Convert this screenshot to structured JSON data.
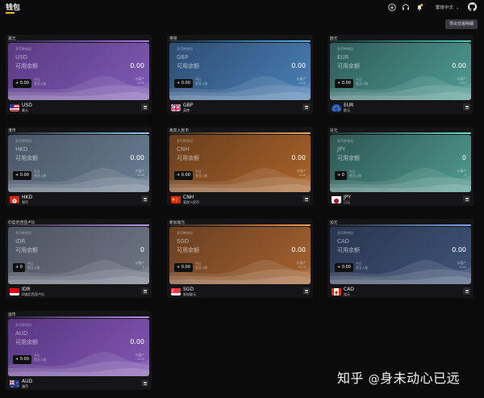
{
  "header": {
    "title": "钱包",
    "language": "繁体中文",
    "export_button": "导出交易明细"
  },
  "wallets": [
    {
      "name": "美元",
      "sub": "多币种钱包",
      "code": "USD",
      "available_label": "可用余额",
      "amount": "0.00",
      "today_change": "+ 0.00",
      "today_label": "今日",
      "today_sub": "营业入账",
      "asset_label": "价值产",
      "asset_value": "0.00",
      "currency_name": "美元",
      "accent": "#b07cf0",
      "panel_from": "#5b3a84",
      "panel_to": "#7e5bb4"
    },
    {
      "name": "英镑",
      "sub": "多币种钱包",
      "code": "GBP",
      "available_label": "可用余额",
      "amount": "0.00",
      "today_change": "+ 0.00",
      "today_label": "今日",
      "today_sub": "营业入账",
      "asset_label": "价值产",
      "asset_value": "0.00",
      "currency_name": "英镑",
      "accent": "#58b8f0",
      "panel_from": "#2d4d74",
      "panel_to": "#4a7fb5"
    },
    {
      "name": "欧元",
      "sub": "多币种钱包",
      "code": "EUR",
      "available_label": "可用余额",
      "amount": "0.00",
      "today_change": "+ 0.00",
      "today_label": "今日",
      "today_sub": "营业入账",
      "asset_label": "价值产",
      "asset_value": "0.00",
      "currency_name": "欧元",
      "accent": "#4fd0c0",
      "panel_from": "#2f5c5a",
      "panel_to": "#4f9c92"
    },
    {
      "name": "港币",
      "sub": "多币种钱包",
      "code": "HKD",
      "available_label": "可用余额",
      "amount": "0.00",
      "today_change": "+ 0.00",
      "today_label": "今日",
      "today_sub": "营业入账",
      "asset_label": "价值产",
      "asset_value": "0.00",
      "currency_name": "港币",
      "accent": "#8ec8f0",
      "panel_from": "#4a5666",
      "panel_to": "#6a7d92"
    },
    {
      "name": "离岸人民币",
      "sub": "多币种钱包",
      "code": "CNH",
      "available_label": "可用余额",
      "amount": "0.00",
      "today_change": "+ 0.00",
      "today_label": "今日",
      "today_sub": "营业入账",
      "asset_label": "价值产",
      "asset_value": "0.00",
      "currency_name": "离岸人民币",
      "accent": "#f0a65a",
      "panel_from": "#6b3f1d",
      "panel_to": "#a8622a"
    },
    {
      "name": "日元",
      "sub": "多币种钱包",
      "code": "JPY",
      "available_label": "可用余额",
      "amount": "0",
      "today_change": "+ 0",
      "today_label": "今日",
      "today_sub": "营业入账",
      "asset_label": "价值产",
      "asset_value": "0",
      "currency_name": "日元",
      "accent": "#6fe0c8",
      "panel_from": "#2f5754",
      "panel_to": "#4f9a8e"
    },
    {
      "name": "印度尼西亚卢比",
      "sub": "多币种钱包",
      "code": "IDR",
      "available_label": "可用余额",
      "amount": "0",
      "today_change": "+ 0",
      "today_label": "今日",
      "today_sub": "营业入账",
      "asset_label": "价值产",
      "asset_value": "0",
      "currency_name": "印度尼西亚卢比",
      "accent": "#b69cf0",
      "panel_from": "#4d5462",
      "panel_to": "#6e7786"
    },
    {
      "name": "新加坡元",
      "sub": "多币种钱包",
      "code": "SGD",
      "available_label": "可用余额",
      "amount": "0.00",
      "today_change": "+ 0.00",
      "today_label": "今日",
      "today_sub": "营业入账",
      "asset_label": "价值产",
      "asset_value": "0.00",
      "currency_name": "新加坡元",
      "accent": "#f0a05a",
      "panel_from": "#6a3f22",
      "panel_to": "#a4622f"
    },
    {
      "name": "加元",
      "sub": "多币种钱包",
      "code": "CAD",
      "available_label": "可用余额",
      "amount": "0.00",
      "today_change": "+ 0.00",
      "today_label": "今日",
      "today_sub": "营业入账",
      "asset_label": "价值产",
      "asset_value": "0.00",
      "currency_name": "加元",
      "accent": "#7aa8f0",
      "panel_from": "#2b3650",
      "panel_to": "#3e5378"
    },
    {
      "name": "澳币",
      "sub": "多币种钱包",
      "code": "AUD",
      "available_label": "可用余额",
      "amount": "0.00",
      "today_change": "+ 0.00",
      "today_label": "今日",
      "today_sub": "营业入账",
      "asset_label": "价值产",
      "asset_value": "0.00",
      "currency_name": "澳币",
      "accent": "#c08cf0",
      "panel_from": "#5a3682",
      "panel_to": "#7f56b2"
    }
  ],
  "watermark": {
    "prefix": "知乎 ",
    "at": "@",
    "handle": "身未动心已远"
  },
  "icons": {
    "download": "download-icon",
    "refresh": "headset-icon",
    "bell": "bell-icon",
    "github": "github-icon",
    "menu": "menu-icon"
  }
}
